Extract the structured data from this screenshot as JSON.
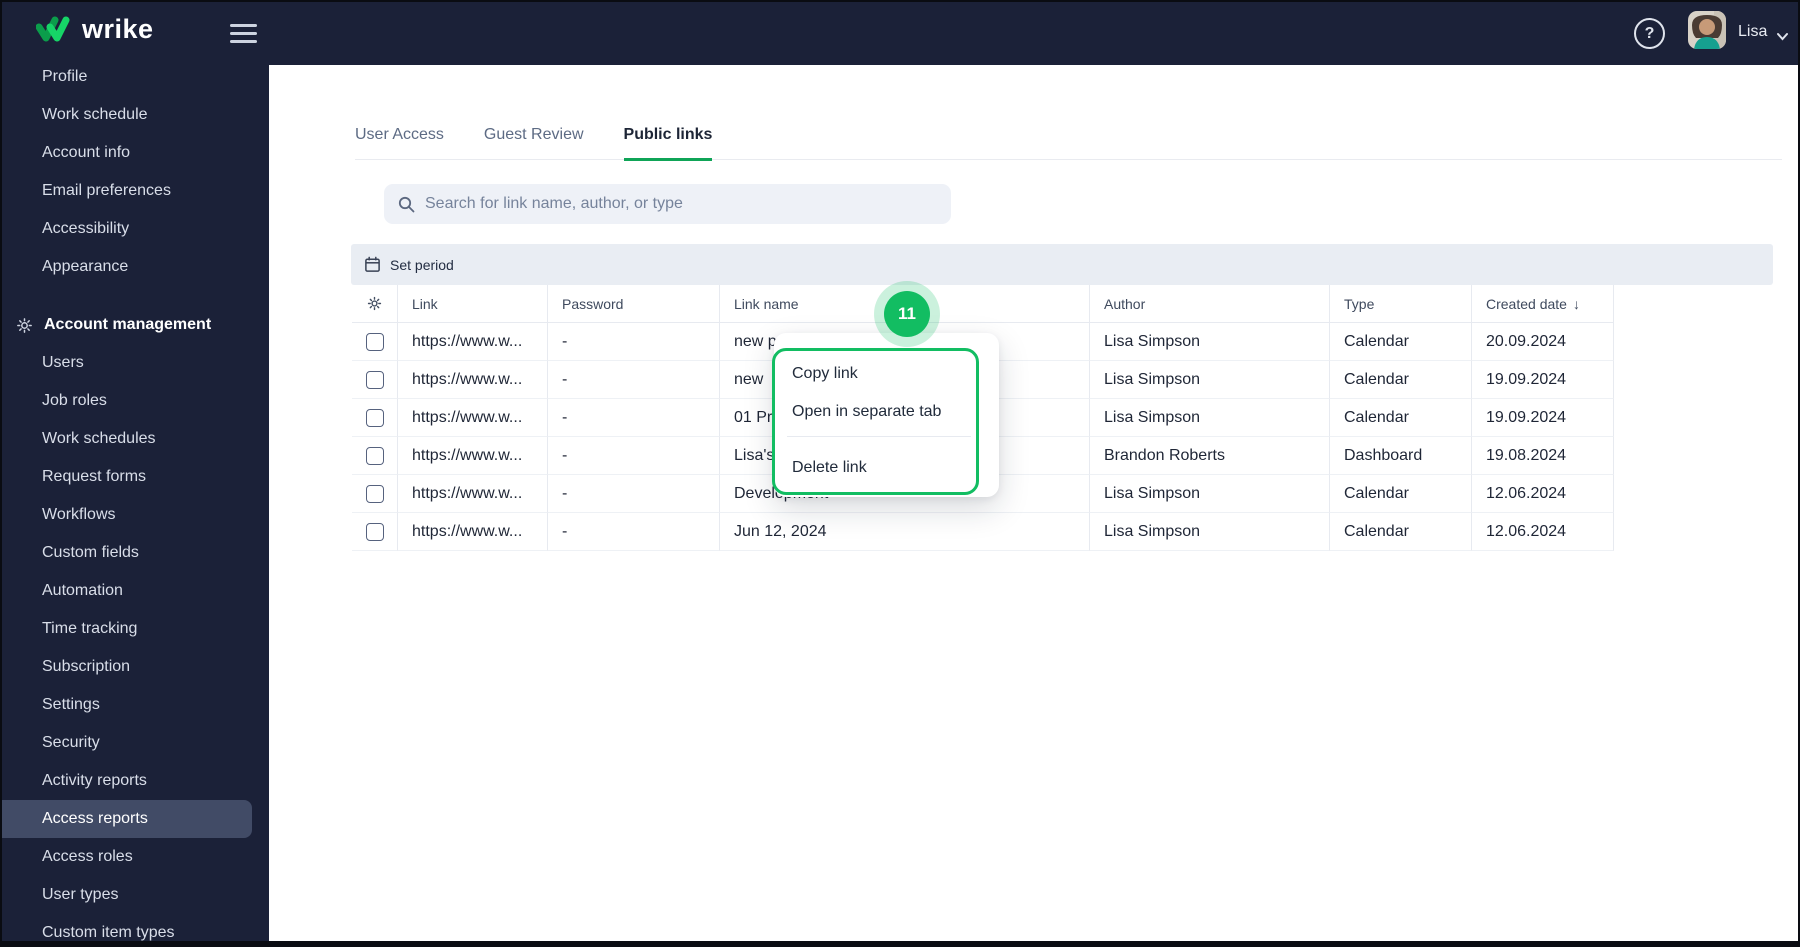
{
  "topbar": {
    "brand": "wrike",
    "help_glyph": "?",
    "user_name": "Lisa"
  },
  "sidebar": {
    "items_top": [
      "Profile",
      "Work schedule",
      "Account info",
      "Email preferences",
      "Accessibility",
      "Appearance"
    ],
    "section_label": "Account management",
    "items_admin": [
      "Users",
      "Job roles",
      "Work schedules",
      "Request forms",
      "Workflows",
      "Custom fields",
      "Automation",
      "Time tracking",
      "Subscription",
      "Settings",
      "Security",
      "Activity reports",
      "Access reports",
      "Access roles",
      "User types",
      "Custom item types"
    ],
    "selected_item": "Access reports"
  },
  "tabs": [
    {
      "label": "User Access"
    },
    {
      "label": "Guest Review"
    },
    {
      "label": "Public links"
    }
  ],
  "active_tab": "Public links",
  "search": {
    "placeholder": "Search for link name, author, or type"
  },
  "toolbar": {
    "set_period_label": "Set period"
  },
  "table": {
    "headers": [
      "Link",
      "Password",
      "Link name",
      "Author",
      "Type",
      "Created date"
    ],
    "sort_glyph": "↓",
    "sorted_by": "Created date",
    "rows": [
      {
        "link": "https://www.w...",
        "password": "-",
        "name": "new public link",
        "author": "Lisa Simpson",
        "type": "Calendar",
        "date": "20.09.2024"
      },
      {
        "link": "https://www.w...",
        "password": "-",
        "name": "new",
        "author": "Lisa Simpson",
        "type": "Calendar",
        "date": "19.09.2024"
      },
      {
        "link": "https://www.w...",
        "password": "-",
        "name": "01 Pr",
        "author": "Lisa Simpson",
        "type": "Calendar",
        "date": "19.09.2024"
      },
      {
        "link": "https://www.w...",
        "password": "-",
        "name": "Lisa's",
        "author": "Brandon Roberts",
        "type": "Dashboard",
        "date": "19.08.2024"
      },
      {
        "link": "https://www.w...",
        "password": "-",
        "name": "Development",
        "author": "Lisa Simpson",
        "type": "Calendar",
        "date": "12.06.2024"
      },
      {
        "link": "https://www.w...",
        "password": "-",
        "name": "Jun 12, 2024",
        "author": "Lisa Simpson",
        "type": "Calendar",
        "date": "12.06.2024"
      }
    ]
  },
  "context_menu": {
    "step_badge": "11",
    "items": [
      "Copy link",
      "Open in separate tab",
      "Delete link"
    ]
  },
  "colors": {
    "navy": "#1B2138",
    "accent_green": "#12BD62",
    "underline_green": "#0FA457",
    "selected_item_bg": "#414B66",
    "table_border": "#E7EAF0",
    "row_border": "#EEF1F5",
    "setbar_bg": "#E9EDF3",
    "search_bg": "#EEF1F7",
    "text_dark": "#1E2433",
    "text_muted": "#5D6B84",
    "sidebar_text": "#D9DEE9"
  }
}
